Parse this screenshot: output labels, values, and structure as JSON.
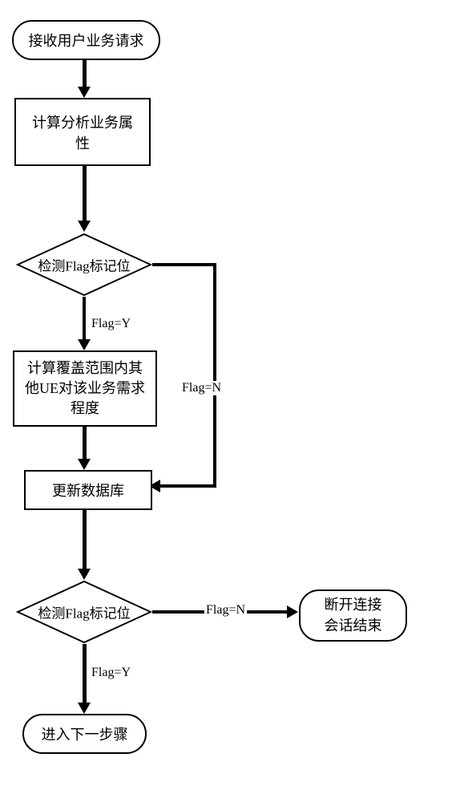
{
  "flowchart": {
    "nodes": {
      "start": "接收用户业务请求",
      "process1": "计算分析业务属性",
      "decision1": "检测Flag标记位",
      "process2": "计算覆盖范围内其他UE对该业务需求程度",
      "process3": "更新数据库",
      "decision2": "检测Flag标记位",
      "end_right": "断开连接\n会话结束",
      "end_right_line1": "断开连接",
      "end_right_line2": "会话结束",
      "end_bottom": "进入下一步骤"
    },
    "edges": {
      "flag_y": "Flag=Y",
      "flag_n": "Flag=N"
    }
  }
}
